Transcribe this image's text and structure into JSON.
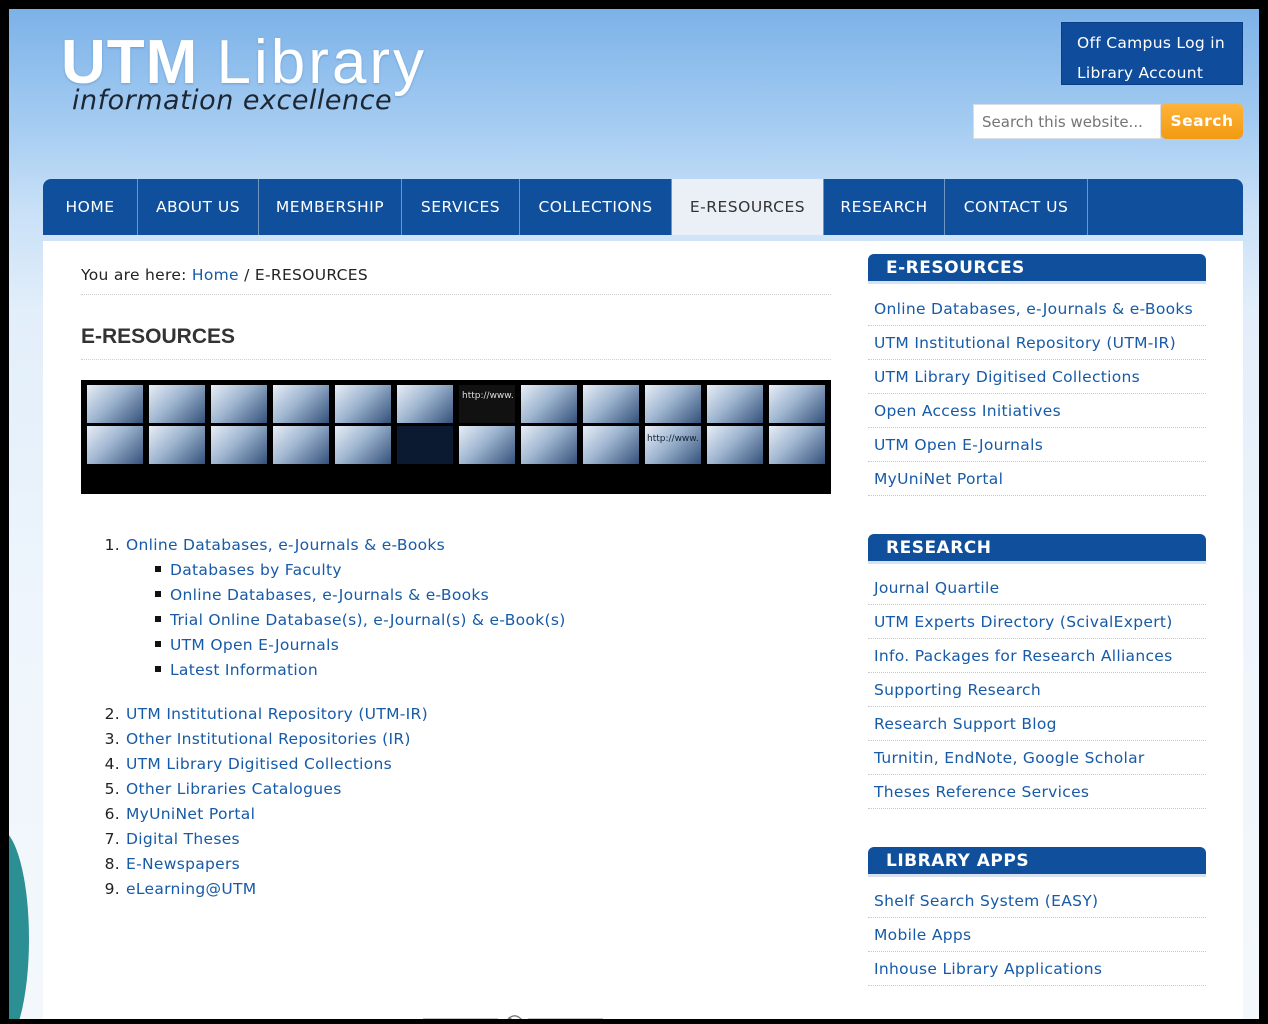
{
  "header": {
    "logo_bold": "UTM",
    "logo_thin": "Library",
    "tagline": "information excellence",
    "account_line1": "Off Campus Log in",
    "account_line2": "Library Account",
    "search_placeholder": "Search this website...",
    "search_button": "Search"
  },
  "nav": {
    "items": [
      {
        "label": "HOME"
      },
      {
        "label": "ABOUT US"
      },
      {
        "label": "MEMBERSHIP"
      },
      {
        "label": "SERVICES"
      },
      {
        "label": "COLLECTIONS"
      },
      {
        "label": "E-RESOURCES",
        "active": true
      },
      {
        "label": "RESEARCH"
      },
      {
        "label": "CONTACT US"
      }
    ]
  },
  "breadcrumb": {
    "prefix": "You are here:",
    "home": "Home",
    "separator": "/",
    "current": "E-RESOURCES"
  },
  "main": {
    "title": "E-RESOURCES",
    "banner_alt_text": [
      "http://www.",
      "http://www."
    ],
    "list": [
      {
        "num": "1.",
        "label": "Online Databases, e-Journals & e-Books",
        "children": [
          "Databases by Faculty",
          "Online Databases, e-Journals & e-Books",
          "Trial Online Database(s), e-Journal(s) & e-Book(s)",
          "UTM Open E-Journals",
          "Latest Information"
        ]
      },
      {
        "num": "2.",
        "label": "UTM Institutional Repository (UTM-IR)"
      },
      {
        "num": "3.",
        "label": "Other Institutional Repositories (IR)"
      },
      {
        "num": "4.",
        "label": "UTM Library Digitised Collections"
      },
      {
        "num": "5.",
        "label": "Other Libraries Catalogues"
      },
      {
        "num": "6.",
        "label": "MyUniNet Portal"
      },
      {
        "num": "7.",
        "label": "Digital Theses"
      },
      {
        "num": "8.",
        "label": "E-Newspapers"
      },
      {
        "num": "9.",
        "label": "eLearning@UTM"
      }
    ]
  },
  "sidebar": {
    "eresources": {
      "title": "E-RESOURCES",
      "items": [
        "Online Databases, e-Journals & e-Books",
        "UTM Institutional Repository (UTM-IR)",
        "UTM Library Digitised Collections",
        "Open Access Initiatives",
        "UTM Open E-Journals",
        "MyUniNet Portal"
      ]
    },
    "research": {
      "title": "RESEARCH",
      "items": [
        "Journal Quartile",
        "UTM Experts Directory (ScivalExpert)",
        "Info. Packages for Research Alliances",
        "Supporting Research",
        "Research Support Blog",
        "Turnitin, EndNote, Google Scholar",
        "Theses Reference Services"
      ]
    },
    "apps": {
      "title": "LIBRARY APPS",
      "items": [
        "Shelf Search System (EASY)",
        "Mobile Apps",
        "Inhouse Library Applications"
      ]
    }
  },
  "colors": {
    "brand_blue": "#0f4f9c",
    "link_blue": "#175aa8",
    "search_orange": "#f29a12"
  }
}
